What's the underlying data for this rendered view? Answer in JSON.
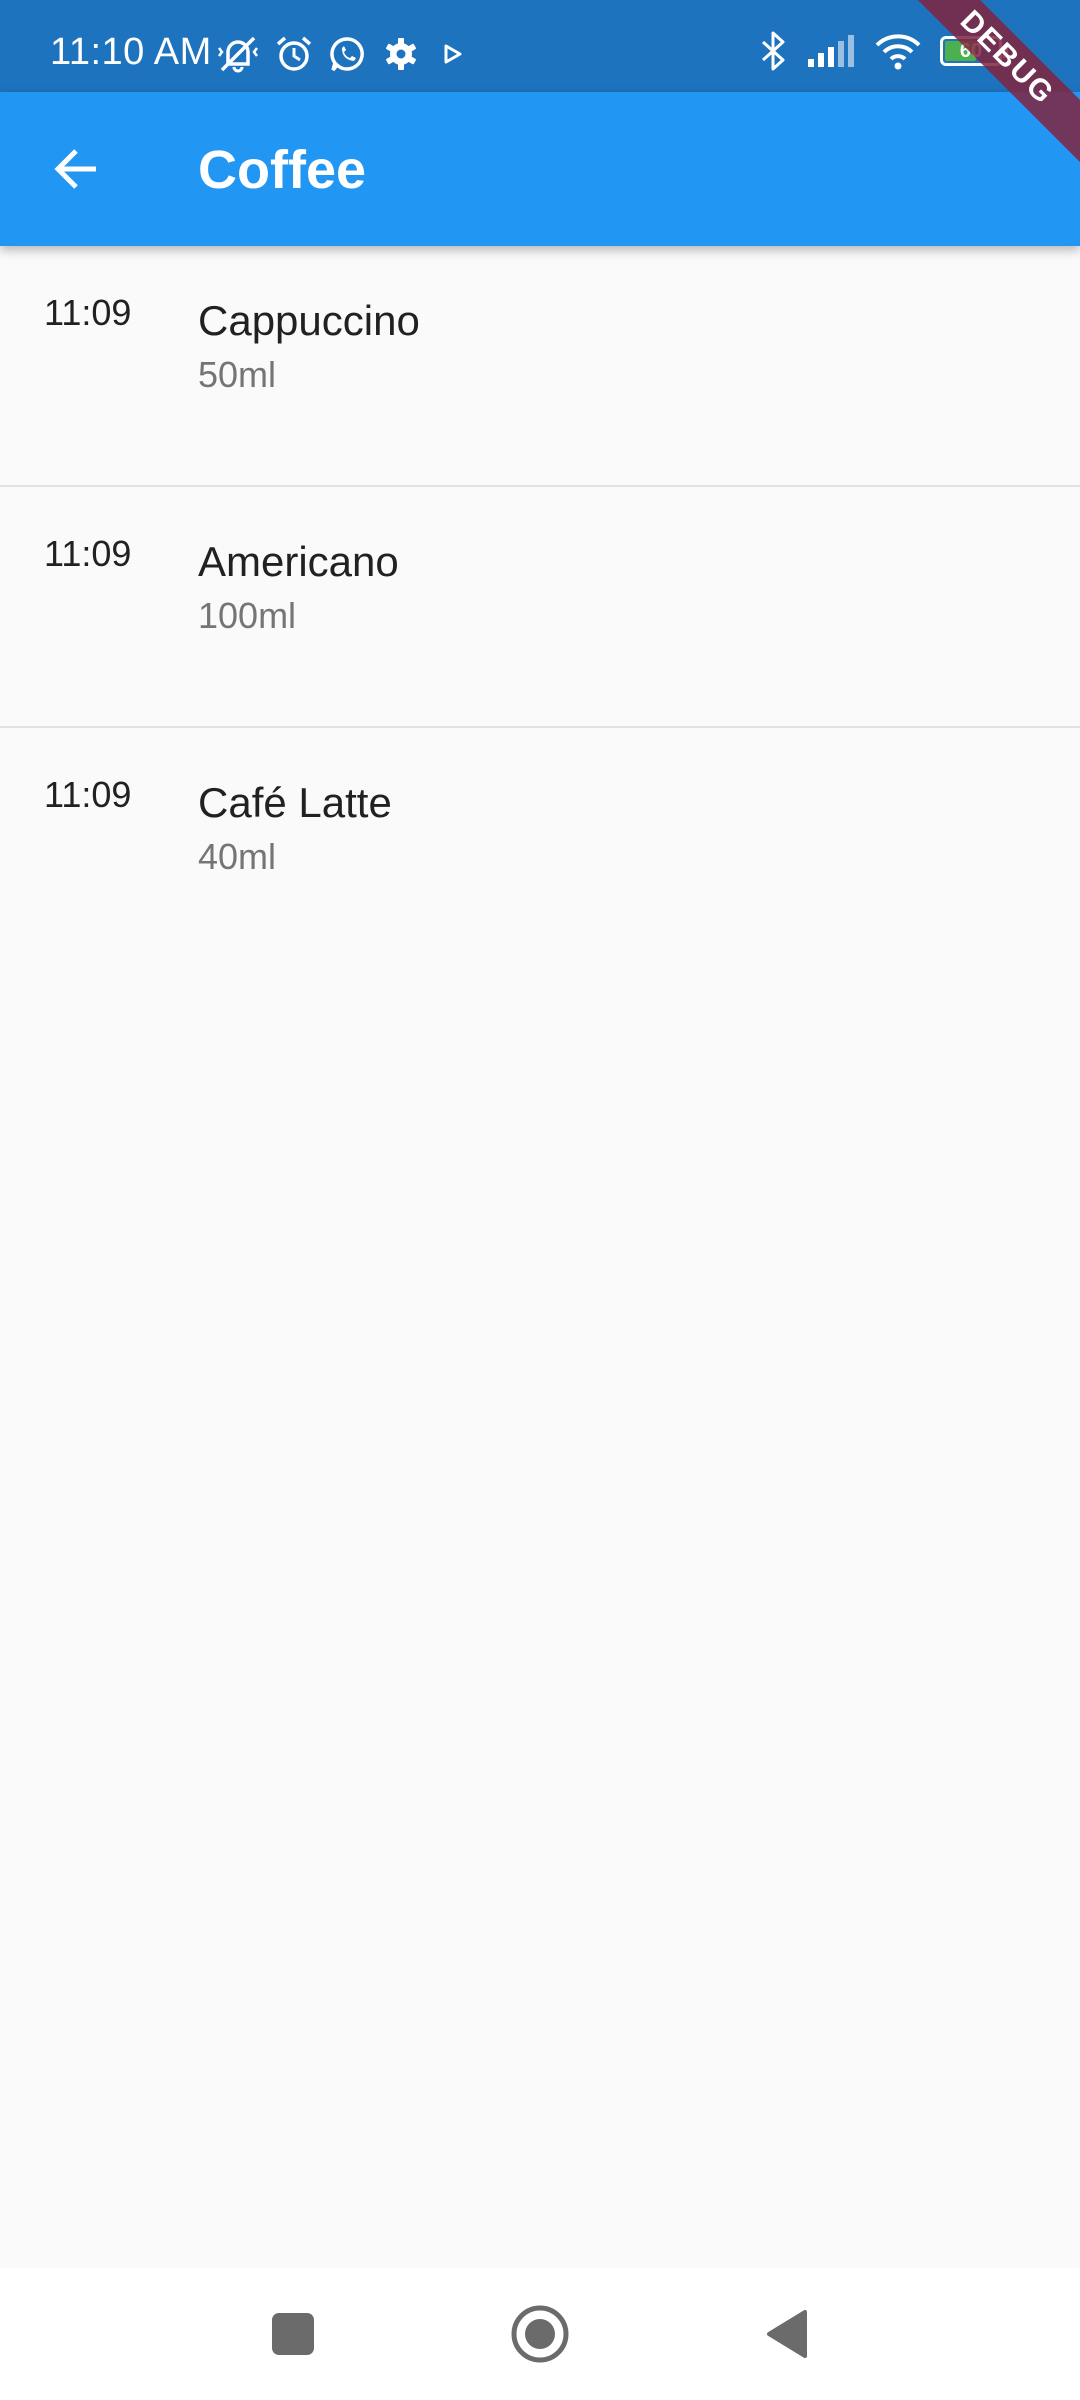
{
  "status_bar": {
    "time": "11:10 AM",
    "left_icons": [
      "mute-vibrate-icon",
      "alarm-icon",
      "whatsapp-icon",
      "settings-icon",
      "play-icon"
    ],
    "right_icons": [
      "bluetooth-icon",
      "signal-icon",
      "wifi-icon",
      "battery-icon"
    ],
    "battery_level": "60",
    "battery_fraction": 0.6,
    "background_color": "#1e73be"
  },
  "debug_banner": "DEBUG",
  "app_bar": {
    "title": "Coffee",
    "back_icon": "arrow-back-icon",
    "background_color": "#2196f3"
  },
  "entries": [
    {
      "time": "11:09",
      "name": "Cappuccino",
      "volume": "50ml"
    },
    {
      "time": "11:09",
      "name": "Americano",
      "volume": "100ml"
    },
    {
      "time": "11:09",
      "name": "Café Latte",
      "volume": "40ml"
    }
  ],
  "nav_bar": {
    "buttons": [
      "recents-square-icon",
      "home-circle-icon",
      "back-triangle-icon"
    ]
  }
}
